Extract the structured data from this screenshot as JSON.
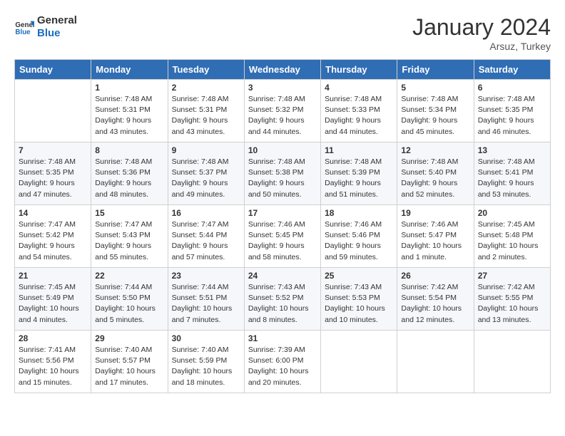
{
  "header": {
    "logo_line1": "General",
    "logo_line2": "Blue",
    "month_title": "January 2024",
    "subtitle": "Arsuz, Turkey"
  },
  "days_of_week": [
    "Sunday",
    "Monday",
    "Tuesday",
    "Wednesday",
    "Thursday",
    "Friday",
    "Saturday"
  ],
  "weeks": [
    [
      {
        "day": "",
        "sunrise": "",
        "sunset": "",
        "daylight": ""
      },
      {
        "day": "1",
        "sunrise": "Sunrise: 7:48 AM",
        "sunset": "Sunset: 5:31 PM",
        "daylight": "Daylight: 9 hours and 43 minutes."
      },
      {
        "day": "2",
        "sunrise": "Sunrise: 7:48 AM",
        "sunset": "Sunset: 5:31 PM",
        "daylight": "Daylight: 9 hours and 43 minutes."
      },
      {
        "day": "3",
        "sunrise": "Sunrise: 7:48 AM",
        "sunset": "Sunset: 5:32 PM",
        "daylight": "Daylight: 9 hours and 44 minutes."
      },
      {
        "day": "4",
        "sunrise": "Sunrise: 7:48 AM",
        "sunset": "Sunset: 5:33 PM",
        "daylight": "Daylight: 9 hours and 44 minutes."
      },
      {
        "day": "5",
        "sunrise": "Sunrise: 7:48 AM",
        "sunset": "Sunset: 5:34 PM",
        "daylight": "Daylight: 9 hours and 45 minutes."
      },
      {
        "day": "6",
        "sunrise": "Sunrise: 7:48 AM",
        "sunset": "Sunset: 5:35 PM",
        "daylight": "Daylight: 9 hours and 46 minutes."
      }
    ],
    [
      {
        "day": "7",
        "sunrise": "Sunrise: 7:48 AM",
        "sunset": "Sunset: 5:35 PM",
        "daylight": "Daylight: 9 hours and 47 minutes."
      },
      {
        "day": "8",
        "sunrise": "Sunrise: 7:48 AM",
        "sunset": "Sunset: 5:36 PM",
        "daylight": "Daylight: 9 hours and 48 minutes."
      },
      {
        "day": "9",
        "sunrise": "Sunrise: 7:48 AM",
        "sunset": "Sunset: 5:37 PM",
        "daylight": "Daylight: 9 hours and 49 minutes."
      },
      {
        "day": "10",
        "sunrise": "Sunrise: 7:48 AM",
        "sunset": "Sunset: 5:38 PM",
        "daylight": "Daylight: 9 hours and 50 minutes."
      },
      {
        "day": "11",
        "sunrise": "Sunrise: 7:48 AM",
        "sunset": "Sunset: 5:39 PM",
        "daylight": "Daylight: 9 hours and 51 minutes."
      },
      {
        "day": "12",
        "sunrise": "Sunrise: 7:48 AM",
        "sunset": "Sunset: 5:40 PM",
        "daylight": "Daylight: 9 hours and 52 minutes."
      },
      {
        "day": "13",
        "sunrise": "Sunrise: 7:48 AM",
        "sunset": "Sunset: 5:41 PM",
        "daylight": "Daylight: 9 hours and 53 minutes."
      }
    ],
    [
      {
        "day": "14",
        "sunrise": "Sunrise: 7:47 AM",
        "sunset": "Sunset: 5:42 PM",
        "daylight": "Daylight: 9 hours and 54 minutes."
      },
      {
        "day": "15",
        "sunrise": "Sunrise: 7:47 AM",
        "sunset": "Sunset: 5:43 PM",
        "daylight": "Daylight: 9 hours and 55 minutes."
      },
      {
        "day": "16",
        "sunrise": "Sunrise: 7:47 AM",
        "sunset": "Sunset: 5:44 PM",
        "daylight": "Daylight: 9 hours and 57 minutes."
      },
      {
        "day": "17",
        "sunrise": "Sunrise: 7:46 AM",
        "sunset": "Sunset: 5:45 PM",
        "daylight": "Daylight: 9 hours and 58 minutes."
      },
      {
        "day": "18",
        "sunrise": "Sunrise: 7:46 AM",
        "sunset": "Sunset: 5:46 PM",
        "daylight": "Daylight: 9 hours and 59 minutes."
      },
      {
        "day": "19",
        "sunrise": "Sunrise: 7:46 AM",
        "sunset": "Sunset: 5:47 PM",
        "daylight": "Daylight: 10 hours and 1 minute."
      },
      {
        "day": "20",
        "sunrise": "Sunrise: 7:45 AM",
        "sunset": "Sunset: 5:48 PM",
        "daylight": "Daylight: 10 hours and 2 minutes."
      }
    ],
    [
      {
        "day": "21",
        "sunrise": "Sunrise: 7:45 AM",
        "sunset": "Sunset: 5:49 PM",
        "daylight": "Daylight: 10 hours and 4 minutes."
      },
      {
        "day": "22",
        "sunrise": "Sunrise: 7:44 AM",
        "sunset": "Sunset: 5:50 PM",
        "daylight": "Daylight: 10 hours and 5 minutes."
      },
      {
        "day": "23",
        "sunrise": "Sunrise: 7:44 AM",
        "sunset": "Sunset: 5:51 PM",
        "daylight": "Daylight: 10 hours and 7 minutes."
      },
      {
        "day": "24",
        "sunrise": "Sunrise: 7:43 AM",
        "sunset": "Sunset: 5:52 PM",
        "daylight": "Daylight: 10 hours and 8 minutes."
      },
      {
        "day": "25",
        "sunrise": "Sunrise: 7:43 AM",
        "sunset": "Sunset: 5:53 PM",
        "daylight": "Daylight: 10 hours and 10 minutes."
      },
      {
        "day": "26",
        "sunrise": "Sunrise: 7:42 AM",
        "sunset": "Sunset: 5:54 PM",
        "daylight": "Daylight: 10 hours and 12 minutes."
      },
      {
        "day": "27",
        "sunrise": "Sunrise: 7:42 AM",
        "sunset": "Sunset: 5:55 PM",
        "daylight": "Daylight: 10 hours and 13 minutes."
      }
    ],
    [
      {
        "day": "28",
        "sunrise": "Sunrise: 7:41 AM",
        "sunset": "Sunset: 5:56 PM",
        "daylight": "Daylight: 10 hours and 15 minutes."
      },
      {
        "day": "29",
        "sunrise": "Sunrise: 7:40 AM",
        "sunset": "Sunset: 5:57 PM",
        "daylight": "Daylight: 10 hours and 17 minutes."
      },
      {
        "day": "30",
        "sunrise": "Sunrise: 7:40 AM",
        "sunset": "Sunset: 5:59 PM",
        "daylight": "Daylight: 10 hours and 18 minutes."
      },
      {
        "day": "31",
        "sunrise": "Sunrise: 7:39 AM",
        "sunset": "Sunset: 6:00 PM",
        "daylight": "Daylight: 10 hours and 20 minutes."
      },
      {
        "day": "",
        "sunrise": "",
        "sunset": "",
        "daylight": ""
      },
      {
        "day": "",
        "sunrise": "",
        "sunset": "",
        "daylight": ""
      },
      {
        "day": "",
        "sunrise": "",
        "sunset": "",
        "daylight": ""
      }
    ]
  ]
}
